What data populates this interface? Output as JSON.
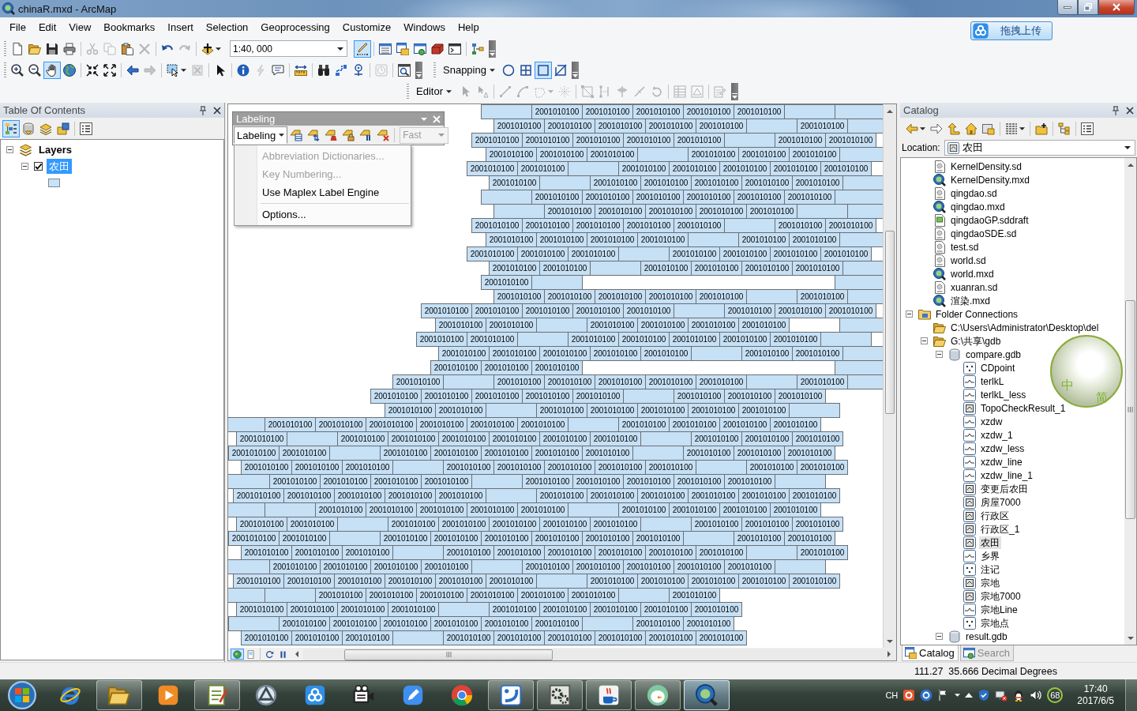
{
  "window": {
    "title": "chinaR.mxd - ArcMap"
  },
  "menu": [
    "File",
    "Edit",
    "View",
    "Bookmarks",
    "Insert",
    "Selection",
    "Geoprocessing",
    "Customize",
    "Windows",
    "Help"
  ],
  "upload_button": {
    "label": "拖拽上传"
  },
  "standard_toolbar": {
    "scale": "1:40, 000",
    "tools": [
      {
        "disabled": false,
        "selected": false
      },
      {
        "disabled": false,
        "selected": false
      },
      {
        "disabled": false,
        "selected": false
      },
      {
        "disabled": false,
        "selected": false
      },
      {
        "disabled": true,
        "selected": false
      },
      {
        "disabled": true,
        "selected": false
      },
      {
        "disabled": false,
        "selected": false
      },
      {
        "disabled": true,
        "selected": false
      },
      {
        "disabled": false,
        "selected": false
      },
      {
        "disabled": true,
        "selected": false
      },
      {
        "disabled": false,
        "selected": false
      },
      {
        "disabled": false,
        "selected": true
      },
      {
        "disabled": false,
        "selected": false
      },
      {
        "disabled": false,
        "selected": false
      },
      {
        "disabled": false,
        "selected": false
      },
      {
        "disabled": false,
        "selected": false
      },
      {
        "disabled": false,
        "selected": false
      },
      {
        "disabled": false,
        "selected": false
      }
    ]
  },
  "tools_toolbar": {
    "tools": [
      {
        "disabled": false,
        "selected": false
      },
      {
        "disabled": false,
        "selected": false
      },
      {
        "disabled": false,
        "selected": true
      },
      {
        "disabled": false,
        "selected": false
      },
      {
        "disabled": false,
        "selected": false
      },
      {
        "disabled": false,
        "selected": false
      },
      {
        "disabled": false,
        "selected": false
      },
      {
        "disabled": true,
        "selected": false
      },
      {
        "disabled": false,
        "selected": false
      },
      {
        "disabled": true,
        "selected": false
      },
      {
        "disabled": false,
        "selected": false
      },
      {
        "disabled": false,
        "selected": false
      },
      {
        "disabled": true,
        "selected": false
      },
      {
        "disabled": false,
        "selected": false
      },
      {
        "disabled": false,
        "selected": false
      },
      {
        "disabled": false,
        "selected": false
      },
      {
        "disabled": false,
        "selected": false
      },
      {
        "disabled": false,
        "selected": false
      },
      {
        "disabled": true,
        "selected": false
      },
      {
        "disabled": false,
        "selected": false
      }
    ]
  },
  "snapping_toolbar": {
    "label": "Snapping",
    "tools": [
      {
        "disabled": false,
        "selected": false
      },
      {
        "disabled": false,
        "selected": false
      },
      {
        "disabled": false,
        "selected": true
      },
      {
        "disabled": false,
        "selected": false
      }
    ]
  },
  "editor_toolbar": {
    "label": "Editor",
    "tools": [
      {
        "disabled": true,
        "selected": false
      },
      {
        "disabled": true,
        "selected": false
      },
      {
        "disabled": true,
        "selected": false
      },
      {
        "disabled": true,
        "selected": false
      },
      {
        "disabled": true,
        "selected": false
      },
      {
        "disabled": true,
        "selected": false
      },
      {
        "disabled": true,
        "selected": false
      },
      {
        "disabled": true,
        "selected": false
      },
      {
        "disabled": true,
        "selected": false
      },
      {
        "disabled": true,
        "selected": false
      },
      {
        "disabled": true,
        "selected": false
      },
      {
        "disabled": true,
        "selected": false
      },
      {
        "disabled": true,
        "selected": false
      },
      {
        "disabled": true,
        "selected": false
      }
    ]
  },
  "toc": {
    "title": "Table Of Contents",
    "tools": [
      {
        "disabled": false,
        "selected": true
      },
      {
        "disabled": false,
        "selected": false
      },
      {
        "disabled": false,
        "selected": false
      },
      {
        "disabled": false,
        "selected": false
      },
      {
        "disabled": false,
        "selected": false
      }
    ],
    "tree": [
      {
        "label": "Layers",
        "expanded": true,
        "selected": false,
        "children": [
          {
            "label": "农田",
            "expanded": true,
            "checked": true,
            "selected": true
          }
        ]
      }
    ]
  },
  "labeling_toolbar": {
    "title": "Labeling",
    "menu_button": {
      "label": "Labeling",
      "expanded": true
    },
    "tools": [
      {
        "disabled": false,
        "selected": false
      },
      {
        "disabled": false,
        "selected": false
      },
      {
        "disabled": false,
        "selected": false
      },
      {
        "disabled": false,
        "selected": false
      },
      {
        "disabled": false,
        "selected": false
      },
      {
        "disabled": false,
        "selected": false
      }
    ],
    "placement": {
      "value": "Fast",
      "disabled": true
    },
    "menu": [
      {
        "label": "Abbreviation Dictionaries...",
        "disabled": true,
        "separator_before": false
      },
      {
        "label": "Key Numbering...",
        "disabled": true,
        "separator_before": false
      },
      {
        "label": "Use Maplex Label Engine",
        "disabled": false,
        "separator_before": false
      },
      {
        "label": "Options...",
        "disabled": false,
        "separator_before": true
      }
    ]
  },
  "map": {
    "view_buttons": [
      {
        "selected": true
      },
      {
        "selected": false
      }
    ],
    "parcel_labels": [
      "2001010100",
      "2001010100",
      "2001010100",
      "2001010100",
      "2001010100",
      "2001010100",
      "2001010100",
      "2001010100",
      "2001010100",
      "2001010100",
      "2001010100",
      "2001010100",
      "2001010100",
      "2001010100",
      "2001010100",
      "2001010100",
      "2001010100",
      "2001010100",
      "2001010100",
      "2001010100",
      "2001010100",
      "2001010100",
      "2001010100",
      "2001010100",
      "2001010100",
      "2001010100",
      "2001010100",
      "2001010100",
      "2001010100",
      "2001010100",
      "2001010100",
      "2001010100",
      "2001010100",
      "2001010100",
      "2001010100",
      "2001010100",
      "2001010100",
      "2001010100",
      "2001010100",
      "2001010100",
      "2001010100",
      "2001010100",
      "2001010100",
      "2001010100",
      "2001010100",
      "2001010100",
      "2001010100",
      "2001010100",
      "2001010100",
      "2001010100",
      "2001010100",
      "2001010100",
      "2001010100",
      "2001010100",
      "2001010100",
      "2001010100",
      "2001010100",
      "2001010100",
      "2001010100",
      "2001010100",
      "2001010100",
      "2001010100",
      "2001010100",
      "2001010100",
      "2001010100",
      "2001010100",
      "2001010100",
      "2001010100",
      "2001010100",
      "2001010100",
      "2001010100",
      "2001010100",
      "2001010100",
      "2001010100",
      "2001010100",
      "2001010100",
      "2001010100",
      "2001010100",
      "2001010100",
      "2001010100",
      "2001010100",
      "2001010100",
      "2001010100",
      "2001010100",
      "2001010100",
      "2001010100",
      "2001010100",
      "2001010100",
      "2001010100",
      "2001010100",
      "2001010100",
      "2001010100",
      "2001010100",
      "2001010100",
      "2001010100",
      "2001010100",
      "2001010100",
      "2001010100",
      "2001010100",
      "2001010100",
      "2001010100",
      "2001010100",
      "2001010100",
      "2001010100",
      "2001010100",
      "2001010100",
      "2001010100",
      "2001010100",
      "2001010100",
      "2001010100",
      "2001010100",
      "2001010100",
      "2001010100",
      "2001010100",
      "2001010100",
      "2001010100",
      "2001010100",
      "2001010100",
      "2001010100",
      "2001010100",
      "2001010100",
      "2001010100",
      "2001010100",
      "2001010100",
      "2001010100",
      "2001010100",
      "2001010100",
      "2001010100",
      "2001010100",
      "2001010100",
      "2001010100",
      "2001010100",
      "2001010100",
      "2001010100",
      "2001010100",
      "2001010100",
      "2001010100",
      "2001010100",
      "2001010100",
      "2001010100",
      "2001010100",
      "2001010100",
      "2001010100",
      "2001010100",
      "2001010100",
      "2001010100",
      "2001010100",
      "2001010100",
      "2001010100",
      "2001010100",
      "2001010100",
      "2001010100",
      "2001010100",
      "2001010100",
      "2001010100",
      "2001010100",
      "2001010100",
      "2001010100",
      "2001010100",
      "2001010100",
      "2001010100",
      "2001010100",
      "2001010100",
      "2001010100",
      "2001010100",
      "2001010100",
      "2001010100",
      "2001010100",
      "2001010100",
      "2001010100",
      "2001010100",
      "2001010100",
      "2001010100",
      "2001010100",
      "2001010100",
      "2001010100",
      "2001010100",
      "2001010100",
      "2001010100",
      "2001010100",
      "2001010100",
      "2001010100",
      "2001010100",
      "2001010100",
      "2001010100",
      "2001010100",
      "2001010100",
      "2001010100",
      "2001010100",
      "2001010100",
      "2001010100",
      "2001010100",
      "2001010100",
      "2001010100",
      "2001010100",
      "2001010100",
      "2001010100",
      "2001010100",
      "2001010100",
      "2001010100",
      "2001010100",
      "2001010100",
      "2001010100",
      "2001010100",
      "2001010100",
      "2001010100",
      "2001010100",
      "2001010100",
      "2001010100",
      "2001010100",
      "2001010100",
      "2001010100",
      "2001010100",
      "2001010100",
      "2001010100",
      "2001010100",
      "2001010100",
      "2001010100",
      "2001010100",
      "2001010100",
      "2001010100",
      "2001010100",
      "2001010100",
      "2001010100",
      "2001010100",
      "2001010100",
      "2001010100",
      "2001010100",
      "2001010100",
      "2001010100",
      "2001010100",
      "2001010100",
      "2001010100",
      "2001010100",
      "2001010100",
      "2001010100",
      "2001010100",
      "2001010100",
      "2001010100",
      "2001010100",
      "2001010100",
      "2001010100",
      "2001010100",
      "2001010100",
      "2001010100",
      "2001010100",
      "2001010100",
      "2001010100",
      "2001010100",
      "2001010100",
      "2001010100",
      "2001010100",
      "2001010100",
      "2001010100",
      "2001010100",
      "2001010100",
      "2001010100",
      "2001010100",
      "2001010100",
      "2001010100",
      "2001010100",
      "2001010100",
      "2001010100",
      "2001010100",
      "2001010100",
      "2001010100",
      "2001010100",
      "2001010100",
      "2001010100",
      "2001010100",
      "2001010100",
      "2001010100",
      "2001010100",
      "2001010100",
      "2001010100",
      "2001010100",
      "2001010100",
      "2001010100",
      "2001010100",
      "2001010100",
      "2001010100",
      "2001010100",
      "2001010100",
      "2001010100",
      "2001010100",
      "2001010100"
    ]
  },
  "catalog": {
    "title": "Catalog",
    "tools": [
      {
        "disabled": false,
        "selected": false
      },
      {
        "disabled": false,
        "selected": false
      },
      {
        "disabled": false,
        "selected": false
      },
      {
        "disabled": false,
        "selected": false
      },
      {
        "disabled": false,
        "selected": false
      },
      {
        "disabled": false,
        "selected": false
      },
      {
        "disabled": false,
        "selected": false
      },
      {
        "disabled": false,
        "selected": false
      },
      {
        "disabled": false,
        "selected": false
      }
    ],
    "location": {
      "label": "Location:",
      "value": "农田"
    },
    "tree": [
      {
        "children": [
          {
            "label": "KernelDensity.sd",
            "kind": "sd",
            "selected": false
          },
          {
            "label": "KernelDensity.mxd",
            "kind": "mxd",
            "selected": false
          },
          {
            "label": "qingdao.sd",
            "kind": "sd",
            "selected": false
          },
          {
            "label": "qingdao.mxd",
            "kind": "mxd",
            "selected": false
          },
          {
            "label": "qingdaoGP.sddraft",
            "kind": "sddraft",
            "selected": false
          },
          {
            "label": "qingdaoSDE.sd",
            "kind": "sd",
            "selected": false
          },
          {
            "label": "test.sd",
            "kind": "sd",
            "selected": false
          },
          {
            "label": "world.sd",
            "kind": "sd",
            "selected": false
          },
          {
            "label": "world.mxd",
            "kind": "mxd",
            "selected": false
          },
          {
            "label": "xuanran.sd",
            "kind": "sd",
            "selected": false
          },
          {
            "label": "渲染.mxd",
            "kind": "mxd",
            "selected": false
          }
        ]
      },
      {
        "label": "Folder Connections",
        "kind": "folder_connections",
        "expanded": true,
        "selected": false,
        "children": [
          {
            "label": "C:\\Users\\Administrator\\Desktop\\del",
            "kind": "folder",
            "selected": false
          },
          {
            "label": "G:\\共享\\gdb",
            "kind": "folder",
            "expanded": true,
            "selected": false,
            "children": [
              {
                "label": "compare.gdb",
                "kind": "gdb",
                "expanded": true,
                "selected": false,
                "children": [
                  {
                    "label": "CDpoint",
                    "kind": "point",
                    "selected": false
                  },
                  {
                    "label": "terlkL",
                    "kind": "line",
                    "selected": false
                  },
                  {
                    "label": "terlkL_less",
                    "kind": "line",
                    "selected": false
                  },
                  {
                    "label": "TopoCheckResult_1",
                    "kind": "polygon",
                    "selected": false
                  },
                  {
                    "label": "xzdw",
                    "kind": "line",
                    "selected": false
                  },
                  {
                    "label": "xzdw_1",
                    "kind": "line",
                    "selected": false
                  },
                  {
                    "label": "xzdw_less",
                    "kind": "line",
                    "selected": false
                  },
                  {
                    "label": "xzdw_line",
                    "kind": "line",
                    "selected": false
                  },
                  {
                    "label": "xzdw_line_1",
                    "kind": "line",
                    "selected": false
                  },
                  {
                    "label": "变更后农田",
                    "kind": "polygon",
                    "selected": false
                  },
                  {
                    "label": "房屋7000",
                    "kind": "polygon",
                    "selected": false
                  },
                  {
                    "label": "行政区",
                    "kind": "polygon",
                    "selected": false
                  },
                  {
                    "label": "行政区_1",
                    "kind": "polygon",
                    "selected": false
                  },
                  {
                    "label": "农田",
                    "kind": "polygon",
                    "selected": true
                  },
                  {
                    "label": "乡界",
                    "kind": "line",
                    "selected": false
                  },
                  {
                    "label": "注记",
                    "kind": "point",
                    "selected": false
                  },
                  {
                    "label": "宗地",
                    "kind": "polygon",
                    "selected": false
                  },
                  {
                    "label": "宗地7000",
                    "kind": "polygon",
                    "selected": false
                  },
                  {
                    "label": "宗地Line",
                    "kind": "line",
                    "selected": false
                  },
                  {
                    "label": "宗地点",
                    "kind": "point",
                    "selected": false
                  }
                ]
              },
              {
                "label": "result.gdb",
                "kind": "gdb",
                "expanded": true,
                "selected": false
              }
            ]
          }
        ]
      }
    ],
    "tabs": [
      {
        "label": "Catalog",
        "selected": true
      },
      {
        "label": "Search",
        "selected": false
      }
    ]
  },
  "ime_widget": {
    "mode": "中",
    "charset": "简"
  },
  "status_bar": {
    "coordinates": "111.27  35.666 Decimal Degrees"
  },
  "taskbar": {
    "apps": [
      {
        "running": false,
        "selected": false
      },
      {
        "running": true,
        "selected": false
      },
      {
        "running": false,
        "selected": false
      },
      {
        "running": true,
        "selected": false
      },
      {
        "running": false,
        "selected": false
      },
      {
        "running": false,
        "selected": false
      },
      {
        "running": false,
        "selected": false
      },
      {
        "running": false,
        "selected": false
      },
      {
        "running": false,
        "selected": false
      },
      {
        "running": true,
        "selected": false
      },
      {
        "running": true,
        "selected": false
      },
      {
        "running": true,
        "selected": false
      },
      {
        "running": true,
        "selected": false
      },
      {
        "running": true,
        "selected": true
      }
    ],
    "tray": {
      "language": "CH",
      "badge": "68",
      "time": "17:40",
      "date": "2017/6/5"
    }
  }
}
